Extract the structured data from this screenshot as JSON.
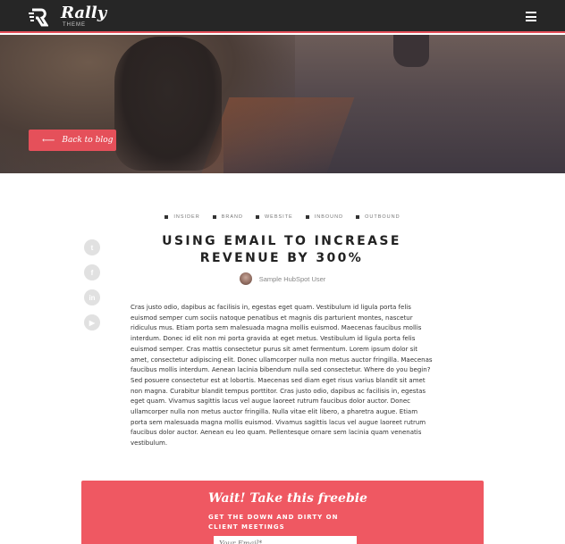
{
  "header": {
    "logo_name": "Rally",
    "logo_sub": "THEME",
    "logo_icon": "rally-logo-icon",
    "menu_icon": "hamburger-menu-icon"
  },
  "hero": {
    "back_label": "Back to blog",
    "back_icon": "arrow-left-icon"
  },
  "tags": [
    "INSIDER",
    "BRAND",
    "WEBSITE",
    "INBOUND",
    "OUTBOUND"
  ],
  "post": {
    "title_line1": "USING EMAIL TO INCREASE",
    "title_line2": "REVENUE BY 300%",
    "author": "Sample HubSpot User",
    "body": "Cras justo odio, dapibus ac facilisis in, egestas eget quam. Vestibulum id ligula porta felis euismod semper cum sociis natoque penatibus et magnis dis parturient montes, nascetur ridiculus mus. Etiam porta sem malesuada magna mollis euismod. Maecenas faucibus mollis interdum. Donec id elit non mi porta gravida at eget metus. Vestibulum id ligula porta felis euismod semper. Cras mattis consectetur purus sit amet fermentum. Lorem ipsum dolor sit amet, consectetur adipiscing elit. Donec ullamcorper nulla non metus auctor fringilla. Maecenas faucibus mollis interdum. Aenean lacinia bibendum nulla sed consectetur. Where do you begin? Sed posuere consectetur est at lobortis. Maecenas sed diam eget risus varius blandit sit amet non magna. Curabitur blandit tempus porttitor. Cras justo odio, dapibus ac facilisis in, egestas eget quam. Vivamus sagittis lacus vel augue laoreet rutrum faucibus dolor auctor. Donec ullamcorper nulla non metus auctor fringilla. Nulla vitae elit libero, a pharetra augue. Etiam porta sem malesuada magna mollis euismod. Vivamus sagittis lacus vel augue laoreet rutrum faucibus dolor auctor. Aenean eu leo quam. Pellentesque ornare sem lacinia quam venenatis vestibulum."
  },
  "social": [
    {
      "icon": "twitter-icon",
      "glyph": "t"
    },
    {
      "icon": "facebook-icon",
      "glyph": "f"
    },
    {
      "icon": "linkedin-icon",
      "glyph": "in"
    },
    {
      "icon": "youtube-icon",
      "glyph": "▶"
    }
  ],
  "cta": {
    "title": "Wait! Take this freebie",
    "subtitle": "GET THE DOWN AND DIRTY ON CLIENT MEETINGS",
    "email_placeholder": "Your Email*"
  },
  "colors": {
    "accent": "#e5505a",
    "header_bg": "#262626",
    "cta_bg": "#ef5862"
  }
}
